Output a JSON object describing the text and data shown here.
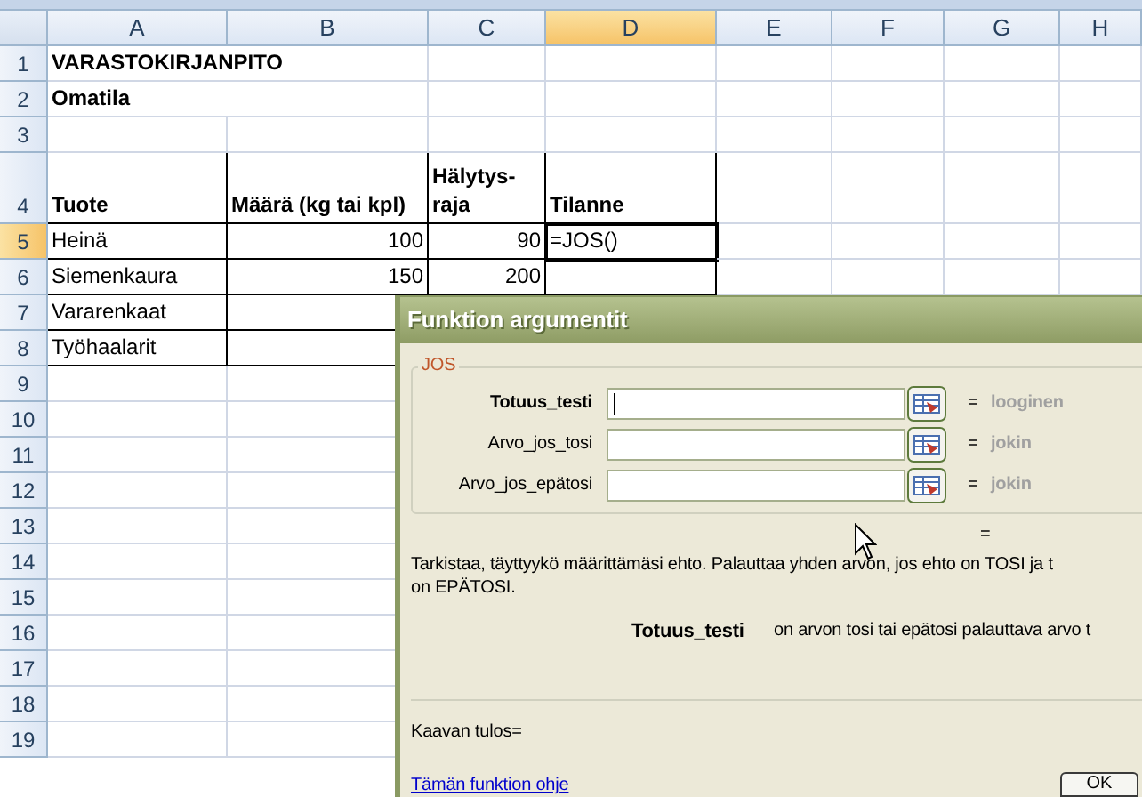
{
  "sheet": {
    "columns": [
      {
        "label": "A",
        "selected": false
      },
      {
        "label": "B",
        "selected": false
      },
      {
        "label": "C",
        "selected": false
      },
      {
        "label": "D",
        "selected": true
      },
      {
        "label": "E",
        "selected": false
      },
      {
        "label": "F",
        "selected": false
      },
      {
        "label": "G",
        "selected": false
      },
      {
        "label": "H",
        "selected": false
      }
    ],
    "rows": [
      {
        "label": "1",
        "selected": false,
        "kind": "title",
        "cells": [
          "VARASTOKIRJANPITO"
        ]
      },
      {
        "label": "2",
        "selected": false,
        "kind": "title",
        "cells": [
          "Omatila"
        ]
      },
      {
        "label": "3",
        "selected": false,
        "kind": "blank",
        "cells": []
      },
      {
        "label": "4",
        "selected": false,
        "kind": "header",
        "cells": [
          "Tuote",
          "Määrä (kg tai kpl)",
          "Hälytys-raja",
          "Tilanne"
        ]
      },
      {
        "label": "5",
        "selected": true,
        "kind": "data",
        "cells": [
          "Heinä",
          "100",
          "90",
          "=JOS()"
        ]
      },
      {
        "label": "6",
        "selected": false,
        "kind": "data",
        "cells": [
          "Siemenkaura",
          "150",
          "200",
          null
        ]
      },
      {
        "label": "7",
        "selected": false,
        "kind": "data",
        "cells": [
          "Vararenkaat",
          null,
          null,
          null
        ]
      },
      {
        "label": "8",
        "selected": false,
        "kind": "data",
        "cells": [
          "Työhaalarit",
          null,
          null,
          null
        ]
      },
      {
        "label": "9",
        "selected": false,
        "kind": "blank",
        "cells": []
      },
      {
        "label": "10",
        "selected": false,
        "kind": "blank",
        "cells": []
      },
      {
        "label": "11",
        "selected": false,
        "kind": "blank",
        "cells": []
      },
      {
        "label": "12",
        "selected": false,
        "kind": "blank",
        "cells": []
      },
      {
        "label": "13",
        "selected": false,
        "kind": "blank",
        "cells": []
      },
      {
        "label": "14",
        "selected": false,
        "kind": "blank",
        "cells": []
      },
      {
        "label": "15",
        "selected": false,
        "kind": "blank",
        "cells": []
      },
      {
        "label": "16",
        "selected": false,
        "kind": "blank",
        "cells": []
      },
      {
        "label": "17",
        "selected": false,
        "kind": "blank",
        "cells": []
      },
      {
        "label": "18",
        "selected": false,
        "kind": "blank",
        "cells": []
      },
      {
        "label": "19",
        "selected": false,
        "kind": "blank",
        "cells": []
      }
    ]
  },
  "dialog": {
    "title": "Funktion argumentit",
    "group": "JOS",
    "arguments": [
      {
        "label": "Totuus_testi",
        "focused": true,
        "equals": "=",
        "result": "looginen"
      },
      {
        "label": "Arvo_jos_tosi",
        "focused": false,
        "equals": "=",
        "result": "jokin"
      },
      {
        "label": "Arvo_jos_epätosi",
        "focused": false,
        "equals": "=",
        "result": "jokin"
      }
    ],
    "total_equals": "=",
    "description": [
      "Tarkistaa, täyttyykö määrittämäsi ehto. Palauttaa yhden arvon, jos ehto on TOSI ja t",
      "on EPÄTOSI."
    ],
    "argument_help": {
      "name": "Totuus_testi",
      "text": "on arvon tosi tai epätosi palauttava arvo t"
    },
    "formula_result": "Kaavan tulos=",
    "help_link": "Tämän funktion ohje",
    "buttons": [
      "OK"
    ]
  }
}
